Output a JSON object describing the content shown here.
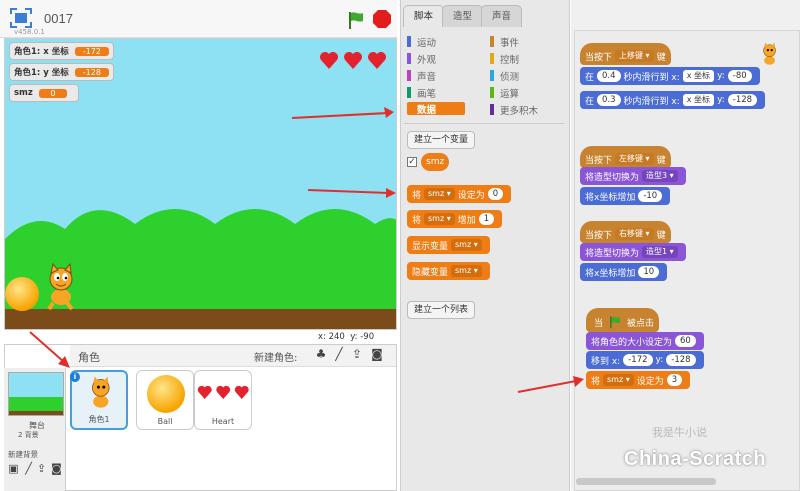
{
  "stage_header": {
    "project_title": "0017",
    "version": "v458.0.1"
  },
  "monitors": [
    {
      "label": "角色1: x 坐标",
      "value": "-172"
    },
    {
      "label": "角色1: y 坐标",
      "value": "-128"
    },
    {
      "label": "smz",
      "value": "0"
    }
  ],
  "stage_coords": {
    "x_label": "x:",
    "x_value": "240",
    "y_label": "y:",
    "y_value": "-90"
  },
  "sprite_pane": {
    "title": "角色",
    "new_sprite_label": "新建角色:",
    "stage_label": "舞台",
    "backdrops_count": "2 背景",
    "new_backdrop_label": "新建背景",
    "sprites": [
      {
        "name": "角色1",
        "selected": true
      },
      {
        "name": "Ball",
        "selected": false
      },
      {
        "name": "Heart",
        "selected": false
      }
    ]
  },
  "palette": {
    "tabs": [
      "脚本",
      "造型",
      "声音"
    ],
    "categories_left": [
      {
        "label": "运动",
        "color": "#4a6cd4"
      },
      {
        "label": "外观",
        "color": "#8a55d7"
      },
      {
        "label": "声音",
        "color": "#bb42c3"
      },
      {
        "label": "画笔",
        "color": "#0e9a6c"
      },
      {
        "label": "数据",
        "color": "#ee7d16"
      }
    ],
    "categories_right": [
      {
        "label": "事件",
        "color": "#c88330"
      },
      {
        "label": "控制",
        "color": "#e1a91a"
      },
      {
        "label": "侦测",
        "color": "#2ca5e2"
      },
      {
        "label": "运算",
        "color": "#5cb712"
      },
      {
        "label": "更多积木",
        "color": "#632d99"
      }
    ],
    "make_variable": "建立一个变量",
    "variable_name": "smz",
    "set_block": {
      "prefix": "将",
      "var": "smz",
      "mid": "设定为",
      "value": "0"
    },
    "change_block": {
      "prefix": "将",
      "var": "smz",
      "mid": "增加",
      "value": "1"
    },
    "show_block": {
      "prefix": "显示变量",
      "var": "smz"
    },
    "hide_block": {
      "prefix": "隐藏变量",
      "var": "smz"
    },
    "make_list": "建立一个列表"
  },
  "scripts": {
    "script1": {
      "hat": {
        "prefix": "当按下",
        "key": "上移键",
        "suffix": "键"
      },
      "glide1": {
        "a": "在",
        "secs": "0.4",
        "b": "秒内滑行到 x:",
        "x": "x 坐标",
        "c": "y:",
        "y": "-80"
      },
      "glide2": {
        "a": "在",
        "secs": "0.3",
        "b": "秒内滑行到 x:",
        "x": "x 坐标",
        "c": "y:",
        "y": "-128"
      }
    },
    "script2": {
      "hat": {
        "prefix": "当按下",
        "key": "左移键",
        "suffix": "键"
      },
      "costume": {
        "prefix": "将造型切换为",
        "value": "造型3"
      },
      "changex": {
        "prefix": "将x坐标增加",
        "value": "-10"
      }
    },
    "script3": {
      "hat": {
        "prefix": "当按下",
        "key": "右移键",
        "suffix": "键"
      },
      "costume": {
        "prefix": "将造型切换为",
        "value": "造型1"
      },
      "changex": {
        "prefix": "将x坐标增加",
        "value": "10"
      }
    },
    "script4": {
      "hat": {
        "prefix": "当",
        "suffix": "被点击"
      },
      "size": {
        "prefix": "将角色的大小设定为",
        "value": "60"
      },
      "goto": {
        "a": "移到 x:",
        "x": "-172",
        "b": "y:",
        "y": "-128"
      },
      "setvar": {
        "prefix": "将",
        "var": "smz",
        "mid": "设定为",
        "value": "3"
      }
    },
    "ghost_text": "我是牛小说",
    "watermark": "China-Scratch"
  },
  "colors": {
    "data_orange": "#ee7d16",
    "arrow_red": "#e0302e",
    "sky": "#8ee0f3",
    "grass": "#2ed02e"
  }
}
